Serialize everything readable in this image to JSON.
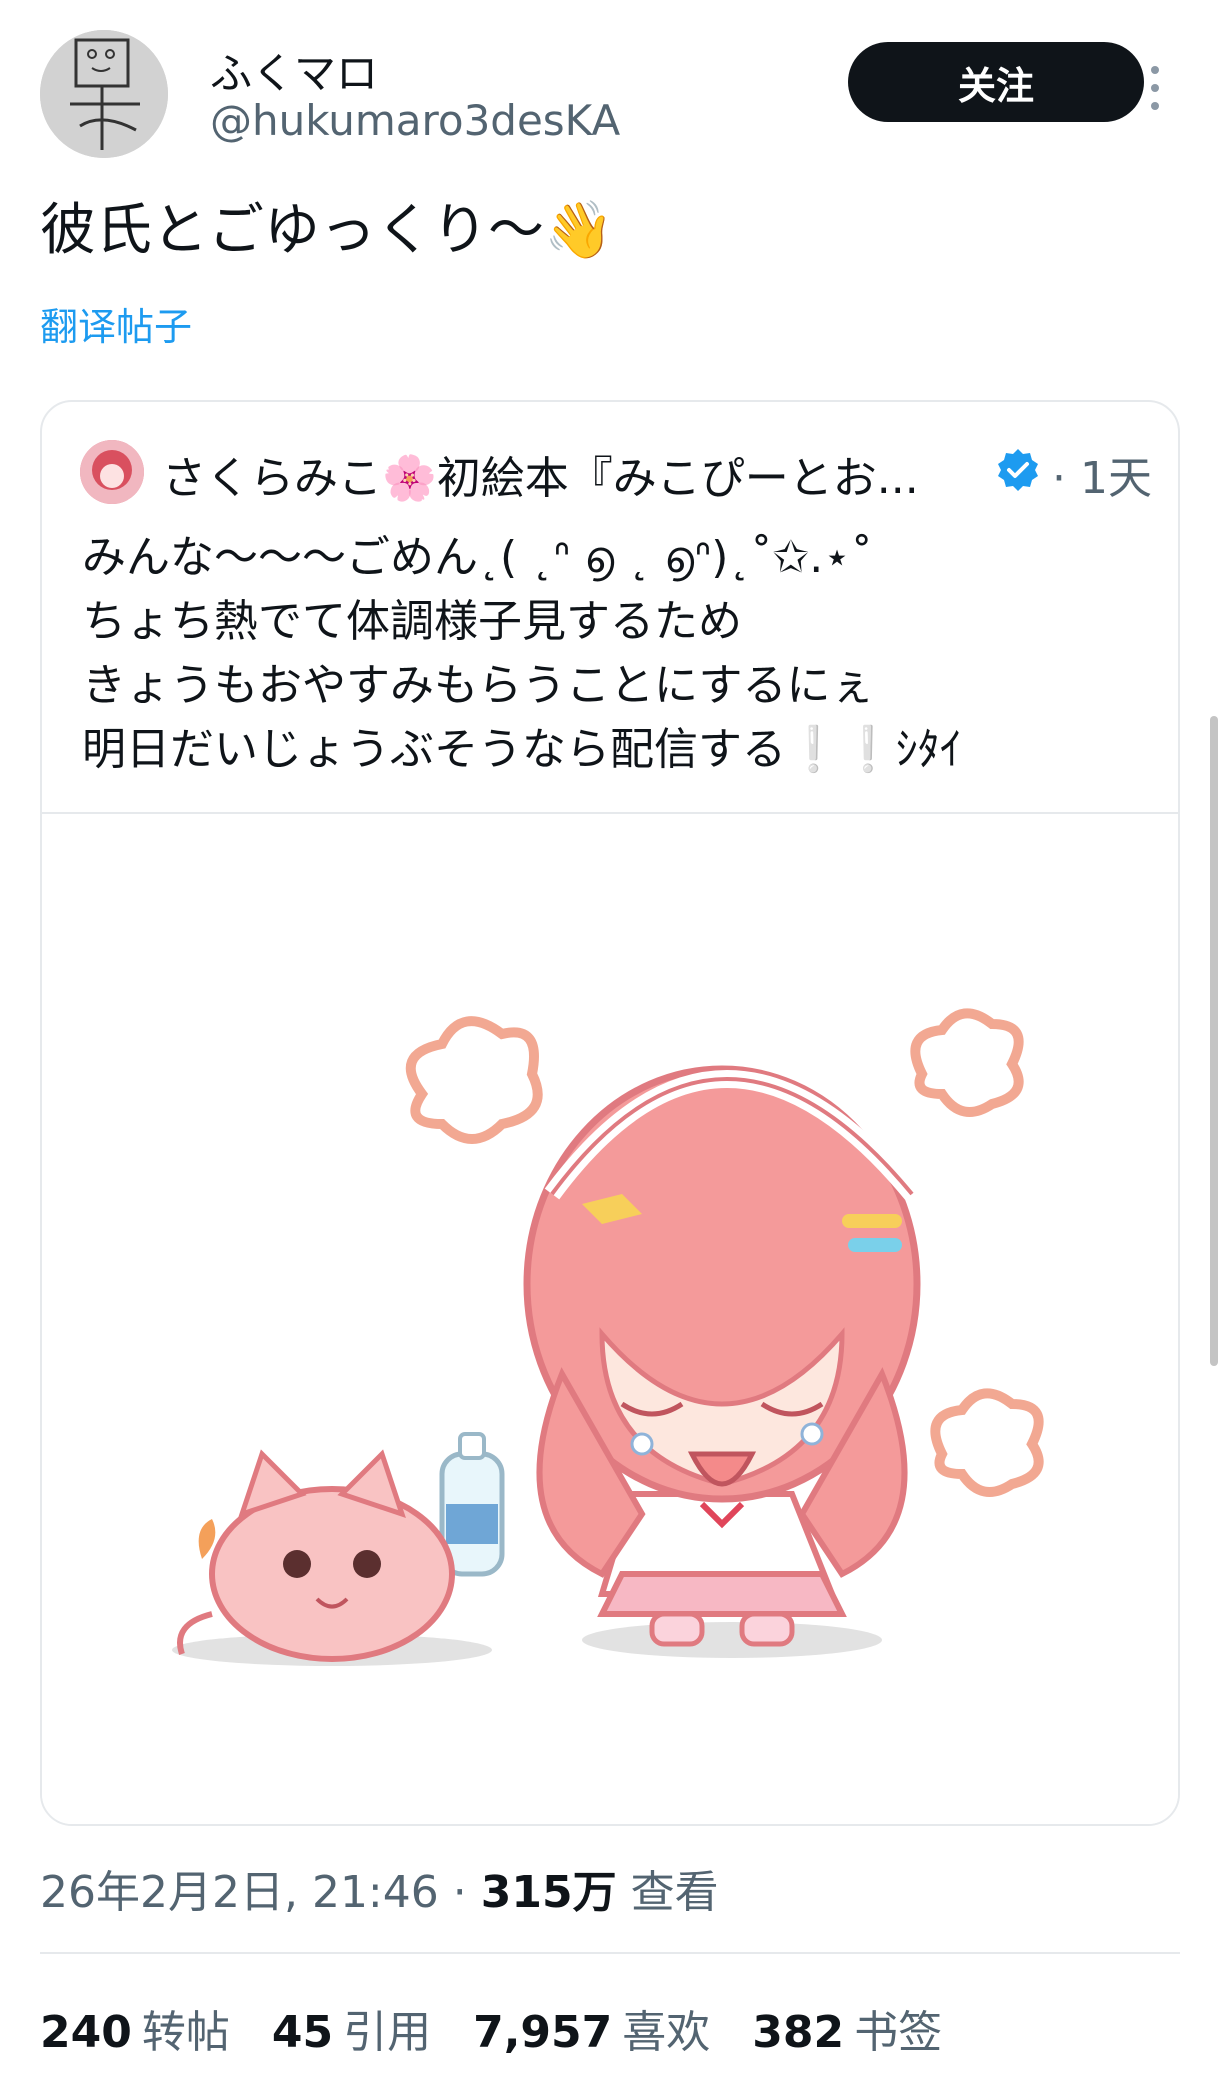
{
  "author": {
    "name": "ふくマロ",
    "handle": "@hukumaro3desKA",
    "follow_label": "关注"
  },
  "tweet": {
    "text": "彼氏とごゆっくり〜👋",
    "translate_label": "翻译帖子"
  },
  "quote": {
    "display_name": "さくらみこ🌸初絵本『みこぴーとお...",
    "time": "· 1天",
    "lines": [
      "みんな〜〜〜ごめん˛( ˛ᐢ ൭ ˛ ൭ᐢ)˛˚✩.⋆˚",
      "ちょち熱でて体調様子見するため",
      "きょうもおやすみもらうことにするにぇ",
      "明日だいじょうぶそうなら配信する❕❕ｼﾀｲ"
    ],
    "image_icon": "illustration-sick-anime-girl-with-pink-cat"
  },
  "meta": {
    "date": "26年2月2日, 21:46",
    "separator": " · ",
    "views_value": "315万",
    "views_label": " 查看"
  },
  "stats": [
    {
      "value": "240",
      "label": "转帖"
    },
    {
      "value": "45",
      "label": "引用"
    },
    {
      "value": "7,957",
      "label": "喜欢"
    },
    {
      "value": "382",
      "label": "书签"
    }
  ],
  "colors": {
    "accent": "#1d9bf0",
    "text": "#0f1419",
    "secondary": "#536471",
    "border": "#e6e9ec"
  }
}
